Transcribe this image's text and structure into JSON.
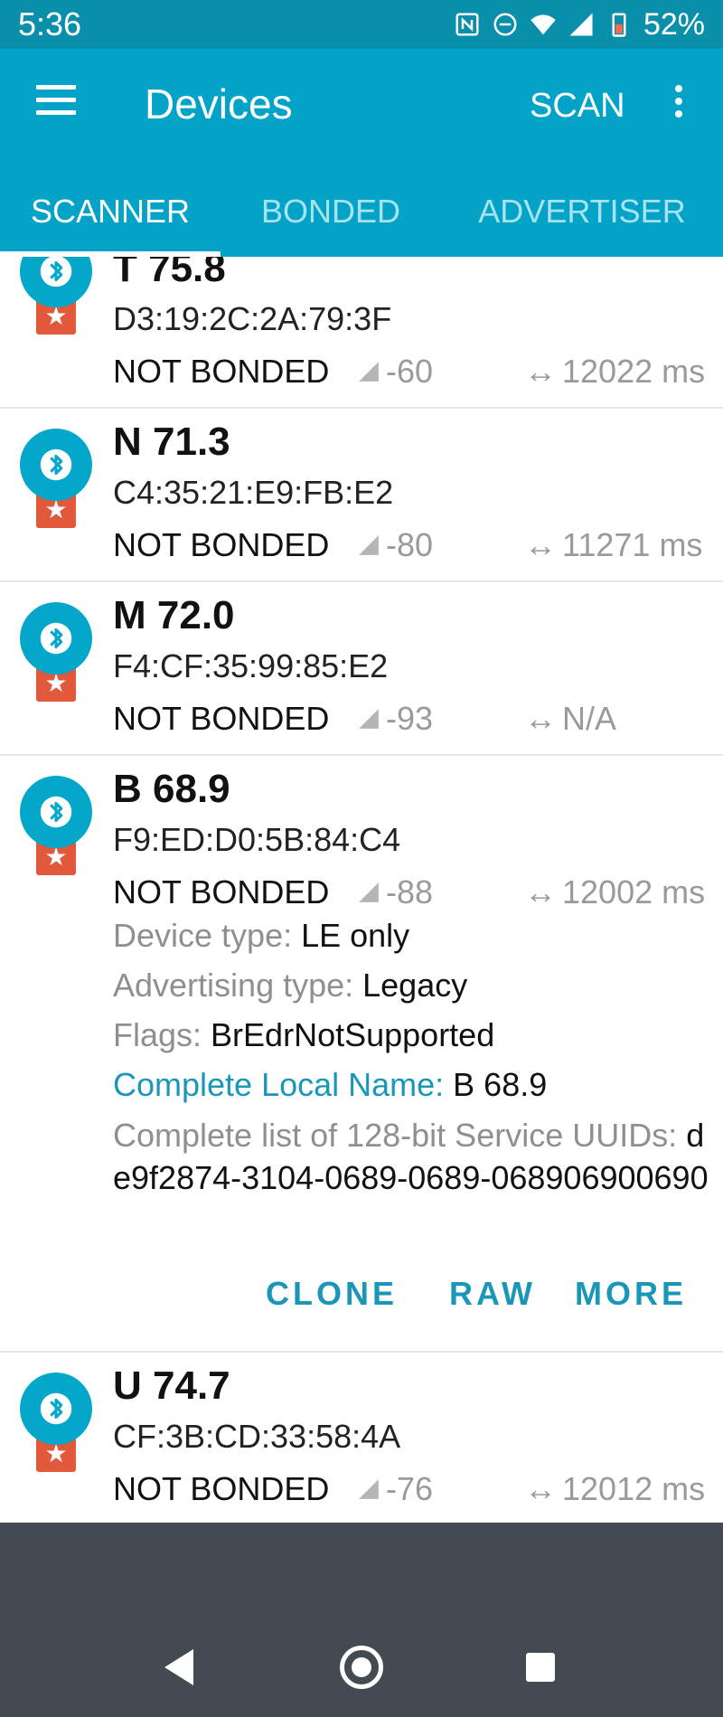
{
  "status_bar": {
    "time": "5:36",
    "battery": "52%"
  },
  "app_bar": {
    "title": "Devices",
    "scan_label": "SCAN"
  },
  "tabs": [
    {
      "label": "SCANNER",
      "active": true
    },
    {
      "label": "BONDED",
      "active": false
    },
    {
      "label": "ADVERTISER",
      "active": false
    }
  ],
  "devices": [
    {
      "name": "T 75.8",
      "mac": "D3:19:2C:2A:79:3F",
      "bond": "NOT BONDED",
      "rssi": "-60",
      "interval": "12022 ms"
    },
    {
      "name": "N 71.3",
      "mac": "C4:35:21:E9:FB:E2",
      "bond": "NOT BONDED",
      "rssi": "-80",
      "interval": "11271 ms"
    },
    {
      "name": "M 72.0",
      "mac": "F4:CF:35:99:85:E2",
      "bond": "NOT BONDED",
      "rssi": "-93",
      "interval": "N/A"
    },
    {
      "name": "B 68.9",
      "mac": "F9:ED:D0:5B:84:C4",
      "bond": "NOT BONDED",
      "rssi": "-88",
      "interval": "12002 ms"
    },
    {
      "name": "U 74.7",
      "mac": "CF:3B:CD:33:58:4A",
      "bond": "NOT BONDED",
      "rssi": "-76",
      "interval": "12012 ms"
    }
  ],
  "expanded": {
    "device_type_key": "Device type: ",
    "device_type_val": "LE only",
    "adv_type_key": "Advertising type: ",
    "adv_type_val": "Legacy",
    "flags_key": "Flags: ",
    "flags_val": "BrEdrNotSupported",
    "local_name_key": "Complete Local Name: ",
    "local_name_val": "B 68.9",
    "uuids_key": "Complete list of 128-bit Service UUIDs: ",
    "uuids_val": "de9f2874-3104-0689-0689-068906900690",
    "actions": {
      "clone": "CLONE",
      "raw": "RAW",
      "more": "MORE"
    }
  },
  "colors": {
    "primary": "#03a3c7",
    "status": "#0a8fab",
    "accent": "#1a97b8",
    "star": "#e2583a",
    "nav": "#434a52"
  }
}
